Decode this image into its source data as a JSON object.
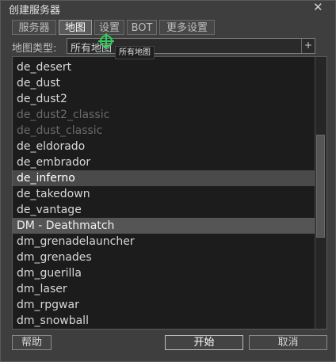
{
  "window": {
    "title": "创建服务器",
    "close_glyph": "✕"
  },
  "tabs": [
    {
      "label": "服务器",
      "active": false
    },
    {
      "label": "地图",
      "active": true
    },
    {
      "label": "设置",
      "active": false
    },
    {
      "label": "BOT",
      "active": false
    },
    {
      "label": "更多设置",
      "active": false
    }
  ],
  "filter": {
    "label": "地图类型:",
    "value": "所有地图",
    "arrow_glyph": "+"
  },
  "tooltip": {
    "text": "所有地图"
  },
  "map_list": [
    {
      "label": "de_desert",
      "state": "normal"
    },
    {
      "label": "de_dust",
      "state": "normal"
    },
    {
      "label": "de_dust2",
      "state": "normal"
    },
    {
      "label": "de_dust2_classic",
      "state": "disabled"
    },
    {
      "label": "de_dust_classic",
      "state": "disabled"
    },
    {
      "label": "de_eldorado",
      "state": "normal"
    },
    {
      "label": "de_embrador",
      "state": "normal"
    },
    {
      "label": "de_inferno",
      "state": "selected"
    },
    {
      "label": "de_takedown",
      "state": "normal"
    },
    {
      "label": "de_vantage",
      "state": "normal"
    },
    {
      "label": "DM - Deathmatch",
      "state": "header"
    },
    {
      "label": "dm_grenadelauncher",
      "state": "normal"
    },
    {
      "label": "dm_grenades",
      "state": "normal"
    },
    {
      "label": "dm_guerilla",
      "state": "normal"
    },
    {
      "label": "dm_laser",
      "state": "normal"
    },
    {
      "label": "dm_rpgwar",
      "state": "normal"
    },
    {
      "label": "dm_snowball",
      "state": "normal"
    }
  ],
  "buttons": {
    "help": "帮助",
    "start": "开始",
    "cancel": "取消"
  },
  "icons": {
    "cursor": "crosshair-cursor-icon"
  },
  "colors": {
    "cursor": "#2fd05a"
  }
}
